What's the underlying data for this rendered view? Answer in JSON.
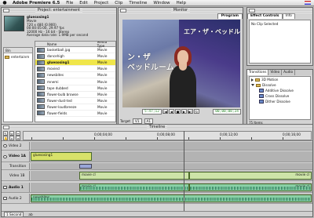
{
  "menubar": {
    "app_name": "Adobe Premiere 6.5",
    "items": [
      "File",
      "Edit",
      "Project",
      "Clip",
      "Timeline",
      "Window",
      "Help"
    ]
  },
  "project": {
    "title": "Project: entertainment",
    "clip_name": "gluesosing1",
    "info": [
      "Movie",
      "720 x 480 (0.900)",
      "00:00:05:00, 29.97 fps",
      "32000 Hz - 16 bit - Stereo",
      "Average data rate: 1.9MB per second"
    ],
    "bin_name": "entertainm",
    "columns": [
      "Name",
      "Media Type"
    ],
    "files": [
      {
        "name": "basketball.jpg",
        "type": "Movie"
      },
      {
        "name": "dancehigh",
        "type": "Movie"
      },
      {
        "name": "gluesosing1",
        "type": "Movie"
      },
      {
        "name": "moviecl",
        "type": "Movie"
      },
      {
        "name": "newsbites",
        "type": "Movie"
      },
      {
        "name": "mnemi",
        "type": "Movie"
      },
      {
        "name": "tape dubbed",
        "type": "Movie"
      },
      {
        "name": "flower-bulb browse",
        "type": "Movie"
      },
      {
        "name": "flower-dust-ted",
        "type": "Movie"
      },
      {
        "name": "flower-loudbreeze",
        "type": "Movie"
      },
      {
        "name": "flower-fields",
        "type": "Movie"
      }
    ]
  },
  "monitor": {
    "title": "Monitor",
    "tab": "Program",
    "jp_left": "ン・ザ\nベッドルーム",
    "jp_right": "エア・ザ・ベッドルーム",
    "timecode_left": "5:47;12",
    "timecode_right": "00;00;08;24",
    "target_label": "Target",
    "target_value": "V1",
    "target_value2": "A1"
  },
  "effect_controls": {
    "title": "Effect Controls",
    "tab": "Info",
    "message": "No Clip Selected"
  },
  "transitions": {
    "tabs": [
      "Transitions",
      "Video",
      "Audio"
    ],
    "groups": [
      {
        "label": "3D Motion",
        "open": false
      },
      {
        "label": "Dissolve",
        "open": true
      }
    ],
    "items": [
      "Additive Dissolve",
      "Cross Dissolve",
      "Dither Dissolve"
    ],
    "footer": "75 Items"
  },
  "timeline": {
    "title": "Timeline",
    "ruler": [
      "0;00;04;00",
      "0;00;08;00",
      "0;00;12;00",
      "0;00;16;00"
    ],
    "tracks": {
      "video2": "Video 2",
      "video1a": "Video 1A",
      "transition": "Transition",
      "video1b": "Video 1B",
      "audio1": "Audio 1",
      "audio2": "Audio 2"
    },
    "clips": {
      "v1a": "gluesosing1",
      "v1b_first": "movie cl",
      "v1b_second": "movie cl",
      "a1_first": "movie cl",
      "a1_second": "movie cl",
      "a2": "newsbites"
    },
    "footer": [
      "1 Second",
      "ab"
    ],
    "colors": {
      "video_clip": "#d8e26a",
      "audio_clip": "#8ad0a6"
    }
  }
}
